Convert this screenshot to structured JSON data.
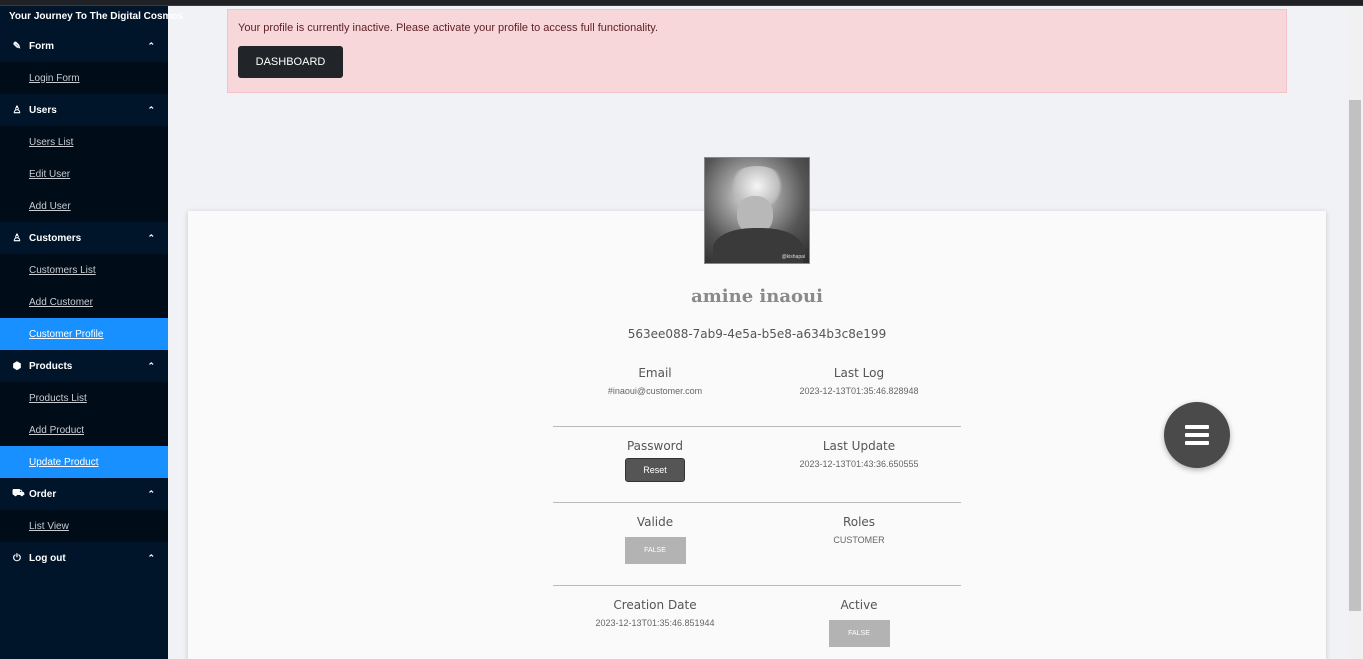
{
  "brand": {
    "tagline": "Your Journey To The Digital Cosmos"
  },
  "sidebar": {
    "groups": [
      {
        "label": "Form",
        "icon": "edit-icon",
        "glyph": "✎",
        "items": [
          {
            "label": "Login Form",
            "active": false
          }
        ]
      },
      {
        "label": "Users",
        "icon": "user-icon",
        "glyph": "♙",
        "items": [
          {
            "label": "Users List"
          },
          {
            "label": "Edit User"
          },
          {
            "label": "Add User"
          }
        ]
      },
      {
        "label": "Customers",
        "icon": "user-icon",
        "glyph": "♙",
        "items": [
          {
            "label": "Customers List"
          },
          {
            "label": "Add Customer"
          },
          {
            "label": "Customer Profile",
            "active": true
          }
        ]
      },
      {
        "label": "Products",
        "icon": "box-icon",
        "glyph": "⬢",
        "items": [
          {
            "label": "Products List"
          },
          {
            "label": "Add Product"
          },
          {
            "label": "Update Product",
            "active": true
          }
        ]
      },
      {
        "label": "Order",
        "icon": "cart-icon",
        "glyph": "⛟",
        "items": [
          {
            "label": "List View"
          }
        ]
      },
      {
        "label": "Log out",
        "icon": "logout-icon",
        "glyph": "⏻",
        "items": []
      }
    ]
  },
  "alert": {
    "message": "Your profile is currently inactive. Please activate your profile to access full functionality.",
    "button": "DASHBOARD"
  },
  "profile": {
    "name": "amine inaoui",
    "id": "563ee088-7ab9-4e5a-b5e8-a634b3c8e199",
    "avatar_watermark": "@kishapai",
    "fields": {
      "email_label": "Email",
      "email": "#inaoui@customer.com",
      "lastlog_label": "Last Log",
      "lastlog": "2023-12-13T01:35:46.828948",
      "password_label": "Password",
      "reset_button": "Reset",
      "lastupdate_label": "Last Update",
      "lastupdate": "2023-12-13T01:43:36.650555",
      "valide_label": "Valide",
      "valide": "FALSE",
      "roles_label": "Roles",
      "roles": "CUSTOMER",
      "creation_label": "Creation Date",
      "creation": "2023-12-13T01:35:46.851944",
      "active_label": "Active",
      "active": "FALSE"
    }
  },
  "colors": {
    "sidebar_bg": "#001529",
    "active_item": "#1890ff",
    "alert_bg": "#f8d7da"
  }
}
